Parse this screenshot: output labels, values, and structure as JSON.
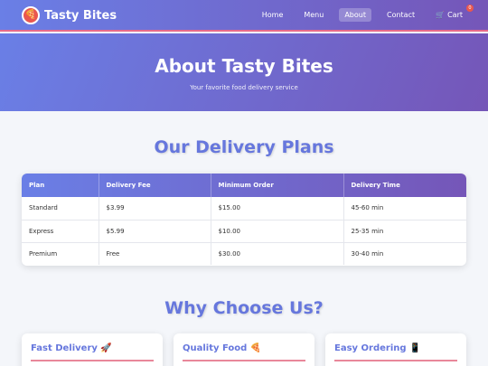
{
  "brand": {
    "logo_icon": "🍕",
    "name": "Tasty Bites"
  },
  "nav": {
    "links": [
      "Home",
      "Menu",
      "About",
      "Contact"
    ],
    "active": "About",
    "cart_icon": "🛒",
    "cart_label": "Cart",
    "cart_count": "0"
  },
  "hero": {
    "title": "About Tasty Bites",
    "subtitle": "Your favorite food delivery service"
  },
  "plans": {
    "heading": "Our Delivery Plans",
    "columns": [
      "Plan",
      "Delivery Fee",
      "Minimum Order",
      "Delivery Time"
    ],
    "rows": [
      [
        "Standard",
        "$3.99",
        "$15.00",
        "45-60 min"
      ],
      [
        "Express",
        "$5.99",
        "$10.00",
        "25-35 min"
      ],
      [
        "Premium",
        "Free",
        "$30.00",
        "30-40 min"
      ]
    ]
  },
  "why": {
    "heading": "Why Choose Us?",
    "features": [
      {
        "title": "Fast Delivery 🚀"
      },
      {
        "title": "Quality Food 🍕"
      },
      {
        "title": "Easy Ordering 📱"
      }
    ]
  },
  "colors": {
    "gradient_start": "#6a7fe6",
    "gradient_end": "#7556b8",
    "accent_pink": "#e9879a",
    "heading_blue": "#6677dd",
    "badge_red": "#e9574f"
  }
}
